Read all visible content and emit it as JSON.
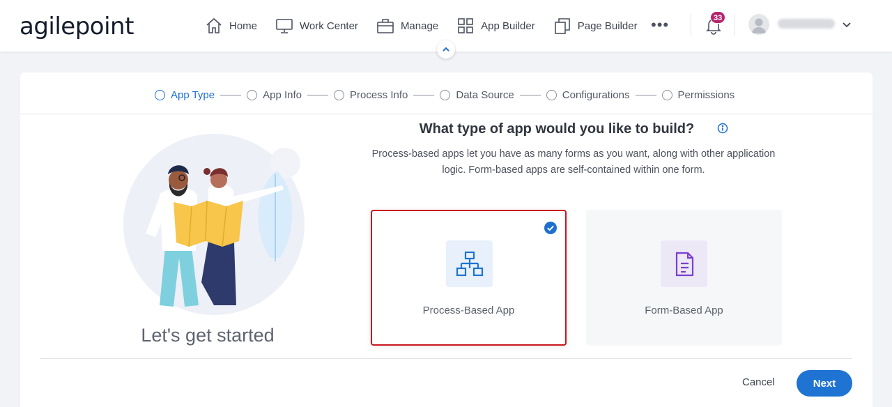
{
  "brand": {
    "logo_text": "agilepoint"
  },
  "nav": {
    "items": [
      {
        "label": "Home",
        "icon": "home-icon"
      },
      {
        "label": "Work Center",
        "icon": "monitor-icon"
      },
      {
        "label": "Manage",
        "icon": "briefcase-icon"
      },
      {
        "label": "App Builder",
        "icon": "grid-icon"
      },
      {
        "label": "Page Builder",
        "icon": "pages-icon"
      }
    ],
    "more_label": "•••",
    "notifications_count": "33"
  },
  "stepper": {
    "steps": [
      "App Type",
      "App Info",
      "Process Info",
      "Data Source",
      "Configurations",
      "Permissions"
    ],
    "active_index": 0
  },
  "intro": {
    "caption": "Let's get started"
  },
  "main": {
    "question": "What type of app would you like to build?",
    "description": "Process-based apps let you have as many forms as you want, along with other application logic. Form-based apps are self-contained within one form."
  },
  "options": [
    {
      "label": "Process-Based App",
      "selected": true,
      "icon": "process-flow-icon"
    },
    {
      "label": "Form-Based App",
      "selected": false,
      "icon": "form-document-icon"
    }
  ],
  "footer": {
    "cancel_label": "Cancel",
    "next_label": "Next"
  },
  "colors": {
    "accent": "#1f73d2",
    "selection_border": "#c8161d",
    "badge": "#b8256e"
  }
}
